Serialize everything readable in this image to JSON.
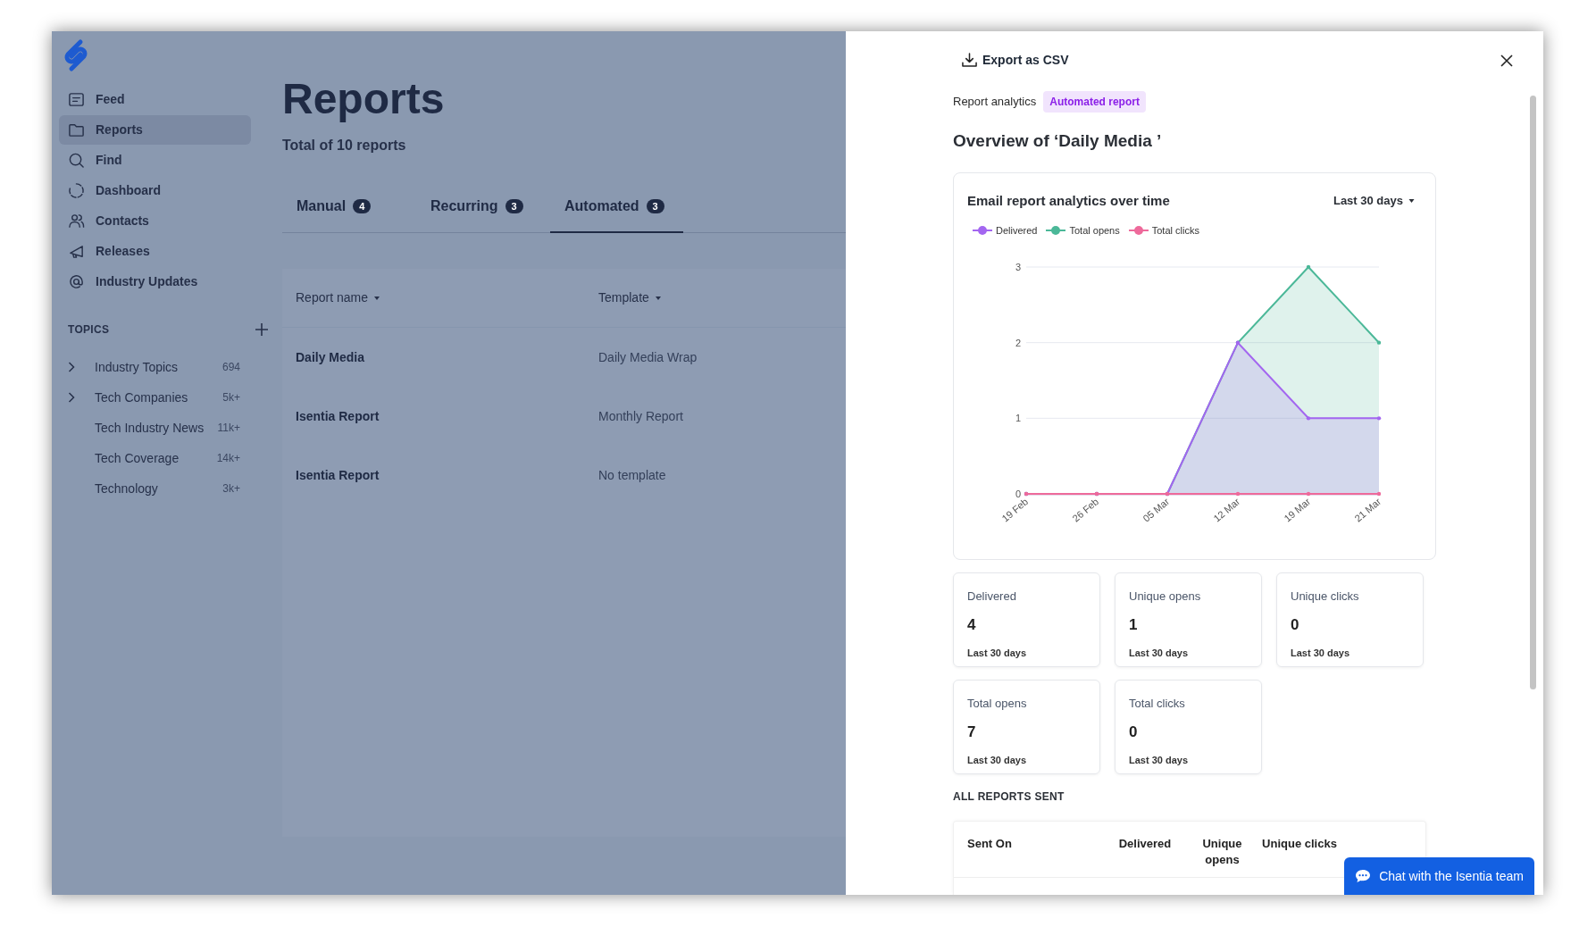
{
  "sidebar": {
    "nav_items": [
      {
        "label": "Feed",
        "selected": false
      },
      {
        "label": "Reports",
        "selected": true
      },
      {
        "label": "Find",
        "selected": false
      },
      {
        "label": "Dashboard",
        "selected": false
      },
      {
        "label": "Contacts",
        "selected": false
      },
      {
        "label": "Releases",
        "selected": false
      },
      {
        "label": "Industry Updates",
        "selected": false
      }
    ],
    "topics": {
      "heading": "TOPICS",
      "items": [
        {
          "label": "Industry Topics",
          "count": "694",
          "has_children": true
        },
        {
          "label": "Tech Companies",
          "count": "5k+",
          "has_children": true
        },
        {
          "label": "Tech Industry News",
          "count": "11k+",
          "has_children": false
        },
        {
          "label": "Tech Coverage",
          "count": "14k+",
          "has_children": false
        },
        {
          "label": "Technology",
          "count": "3k+",
          "has_children": false
        }
      ]
    }
  },
  "main": {
    "title": "Reports",
    "subtitle": "Total of 10 reports",
    "tabs": [
      {
        "label": "Manual",
        "count": "4",
        "selected": false
      },
      {
        "label": "Recurring",
        "count": "3",
        "selected": false
      },
      {
        "label": "Automated",
        "count": "3",
        "selected": true
      }
    ],
    "table": {
      "columns": [
        "Report name",
        "Template"
      ],
      "rows": [
        {
          "report_name": "Daily Media",
          "template": "Daily Media Wrap"
        },
        {
          "report_name": "Isentia Report",
          "template": "Monthly Report"
        },
        {
          "report_name": "Isentia Report",
          "template": "No template"
        }
      ]
    }
  },
  "panel": {
    "export_button": "Export as CSV",
    "breadcrumb": "Report analytics",
    "badge": "Automated report",
    "heading": "Overview of ‘Daily Media ’",
    "chart_card": {
      "title": "Email report analytics over time",
      "range": "Last 30 days",
      "chart_data": {
        "type": "area",
        "categories": [
          "19 Feb",
          "26 Feb",
          "05 Mar",
          "12 Mar",
          "19 Mar",
          "21 Mar"
        ],
        "ylim": [
          0,
          3
        ],
        "yticks": [
          0,
          1,
          2,
          3
        ],
        "series": [
          {
            "name": "Delivered",
            "color": "#a366f0",
            "values": [
              0,
              0,
              0,
              2,
              1,
              1
            ]
          },
          {
            "name": "Total opens",
            "color": "#4bb898",
            "values": [
              0,
              0,
              0,
              2,
              3,
              2
            ]
          },
          {
            "name": "Total clicks",
            "color": "#ee6a9b",
            "values": [
              0,
              0,
              0,
              0,
              0,
              0
            ]
          }
        ]
      }
    },
    "stats": [
      {
        "label": "Delivered",
        "value": "4",
        "period": "Last 30 days"
      },
      {
        "label": "Unique opens",
        "value": "1",
        "period": "Last 30 days"
      },
      {
        "label": "Unique clicks",
        "value": "0",
        "period": "Last 30 days"
      },
      {
        "label": "Total opens",
        "value": "7",
        "period": "Last 30 days"
      },
      {
        "label": "Total clicks",
        "value": "0",
        "period": "Last 30 days"
      }
    ],
    "sent_section": {
      "heading": "ALL REPORTS SENT",
      "columns": [
        "Sent On",
        "Delivered",
        "Unique opens",
        "Unique clicks"
      ]
    },
    "chat_button": "Chat with the Isentia team"
  }
}
